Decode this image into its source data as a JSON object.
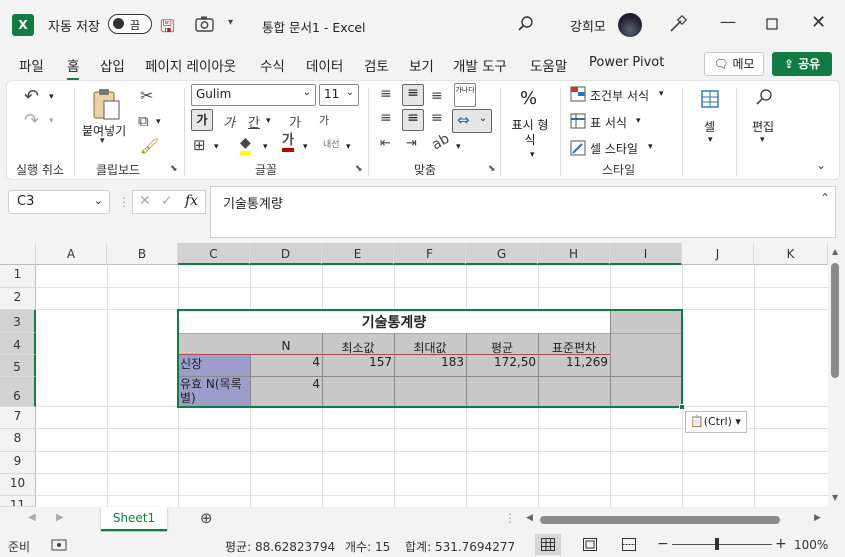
{
  "titlebar": {
    "app_icon": "X",
    "autosave_label": "자동 저장",
    "autosave_state": "끔",
    "doc_title": "통합 문서1  -  Excel",
    "user_name": "강희모"
  },
  "menu": {
    "tabs": [
      "파일",
      "홈",
      "삽입",
      "페이지 레이아웃",
      "수식",
      "데이터",
      "검토",
      "보기",
      "개발 도구",
      "도움말",
      "Power Pivot"
    ],
    "active": "홈",
    "memo_label": "메모",
    "share_label": "공유"
  },
  "ribbon": {
    "undo_group": "실행 취소",
    "clipboard": {
      "paste_label": "붙여넣기",
      "group": "클립보드"
    },
    "font": {
      "name": "Gulim",
      "size": "11",
      "bold": "가",
      "italic": "가",
      "underline": "간",
      "grow": "가",
      "shrink": "가",
      "phonetic": "내선",
      "group": "글꼴"
    },
    "align": {
      "wrap": "가나다",
      "group": "맞춤"
    },
    "number": {
      "icon": "%",
      "label": "표시 형식",
      "group": ""
    },
    "styles": {
      "cond": "조건부 서식",
      "table": "표 서식",
      "cell": "셀 스타일",
      "group": "스타일"
    },
    "cells": {
      "label": "셀"
    },
    "editing": {
      "label": "편집"
    }
  },
  "formula_bar": {
    "name_box": "C3",
    "fx": "fx",
    "content": "기술통계량"
  },
  "grid": {
    "columns": [
      "A",
      "B",
      "C",
      "D",
      "E",
      "F",
      "G",
      "H",
      "I",
      "J",
      "K"
    ],
    "selected_columns": [
      "C",
      "D",
      "E",
      "F",
      "G",
      "H",
      "I"
    ],
    "rows": [
      "1",
      "2",
      "3",
      "4",
      "5",
      "6",
      "7",
      "8",
      "9",
      "10",
      "11"
    ],
    "selected_rows": [
      "3",
      "4",
      "5",
      "6"
    ],
    "table": {
      "title": "기술통계량",
      "headers": [
        "N",
        "최소값",
        "최대값",
        "평균",
        "표준편차"
      ],
      "rows": [
        {
          "label": "신장",
          "values": [
            "4",
            "157",
            "183",
            "172,50",
            "11,269"
          ]
        },
        {
          "label": "유효 N(목록별)",
          "values": [
            "4",
            "",
            "",
            "",
            ""
          ]
        }
      ]
    },
    "paste_options": "(Ctrl)"
  },
  "sheets": {
    "tabs": [
      "Sheet1"
    ],
    "active": "Sheet1"
  },
  "status": {
    "ready": "준비",
    "average": "평균: 88.62823794",
    "count": "개수: 15",
    "sum": "합계: 531.7694277",
    "zoom": "100%"
  }
}
